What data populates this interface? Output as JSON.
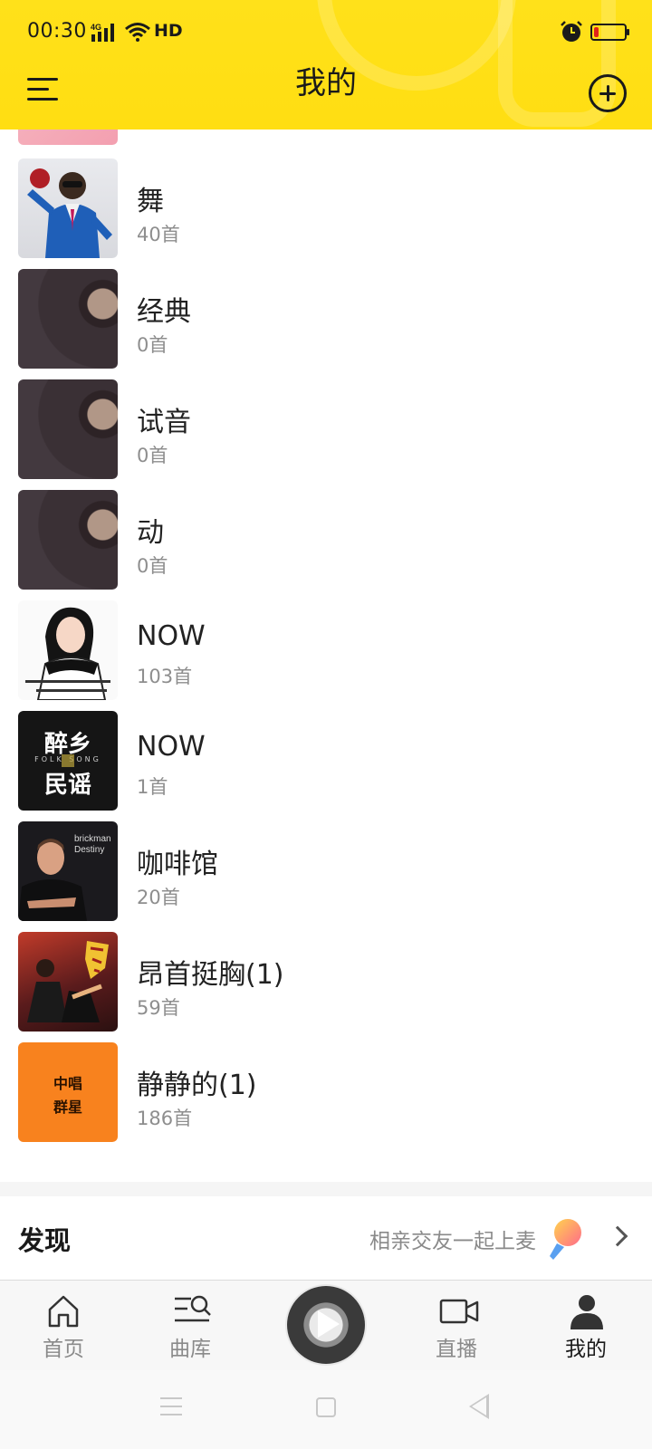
{
  "status_bar": {
    "time": "00:30",
    "network": "4G",
    "hd": "HD",
    "battery_level": 0.15,
    "battery_color": "#e0231b"
  },
  "header": {
    "title": "我的",
    "menu_icon": "menu-icon",
    "add_icon": "add-circle-icon",
    "background_color": "#ffe11a"
  },
  "playlists": [
    {
      "title": "",
      "count": "",
      "cover": "pink-cover"
    },
    {
      "title": "舞",
      "count": "40首",
      "cover": "dance-cover"
    },
    {
      "title": "经典",
      "count": "0首",
      "cover": "vinyl-cover"
    },
    {
      "title": "试音",
      "count": "0首",
      "cover": "vinyl-cover"
    },
    {
      "title": "动",
      "count": "0首",
      "cover": "vinyl-cover"
    },
    {
      "title": "NOW",
      "count": "103首",
      "cover": "woman-cover"
    },
    {
      "title": "NOW",
      "count": "1首",
      "cover": "folk-cover"
    },
    {
      "title": "咖啡馆",
      "count": "20首",
      "cover": "man-cover"
    },
    {
      "title": "昂首挺胸(1)",
      "count": "59首",
      "cover": "kungfu-cover"
    },
    {
      "title": "静静的(1)",
      "count": "186首",
      "cover": "orange-cover"
    }
  ],
  "covers": {
    "folk_line1": "醉乡",
    "folk_line2": "民谣",
    "folk_subtitle": "FOLK SONG",
    "man_text1": "brickman",
    "man_text2": "Destiny",
    "orange_line1": "中唱",
    "orange_line2": "群星"
  },
  "discover": {
    "title": "发现",
    "subtitle": "相亲交友一起上麦"
  },
  "bottom_nav": [
    {
      "label": "首页",
      "icon": "home-icon",
      "active": false
    },
    {
      "label": "曲库",
      "icon": "library-search-icon",
      "active": false
    },
    {
      "label": "",
      "icon": "play-icon",
      "active": false
    },
    {
      "label": "直播",
      "icon": "video-camera-icon",
      "active": false
    },
    {
      "label": "我的",
      "icon": "user-icon",
      "active": true
    }
  ]
}
